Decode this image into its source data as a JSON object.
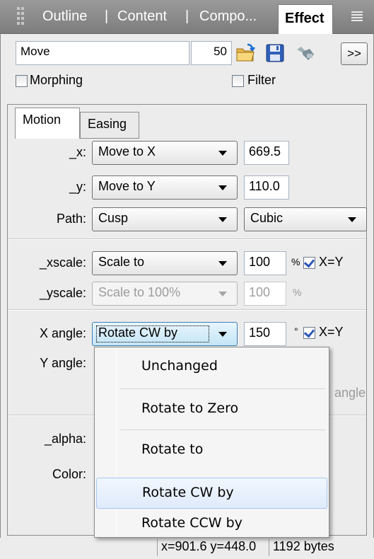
{
  "tabs": [
    {
      "label": "Outline"
    },
    {
      "label": "Content"
    },
    {
      "label": "Compo..."
    },
    {
      "label": "Effect"
    }
  ],
  "tabs_separator": "|",
  "effect": {
    "name_value": "Move",
    "frames_value": "50",
    "more_label": ">>"
  },
  "options": {
    "morphing_label": "Morphing",
    "morphing_checked": false,
    "filter_label": "Filter",
    "filter_checked": false
  },
  "subtabs": {
    "motion": "Motion",
    "easing": "Easing"
  },
  "motion": {
    "x_label": "_x:",
    "x_mode": "Move to X",
    "x_value": "669.5",
    "y_label": "_y:",
    "y_mode": "Move to Y",
    "y_value": "110.0",
    "path_label": "Path:",
    "path_mode": "Cusp",
    "path_curve": "Cubic",
    "xscale_label": "_xscale:",
    "xscale_mode": "Scale to",
    "xscale_value": "100",
    "xscale_unit": "%",
    "xy_label": "X=Y",
    "xy_checked": true,
    "yscale_label": "_yscale:",
    "yscale_mode": "Scale to 100%",
    "yscale_value": "100",
    "yscale_unit": "%",
    "xangle_label": "X angle:",
    "xangle_mode": "Rotate CW by",
    "xangle_value": "150",
    "xangle_unit": "°",
    "xangle_xy_label": "X=Y",
    "xangle_xy_checked": true,
    "yangle_label": "Y angle:",
    "angle_partial_label": "angle",
    "alpha_label": "_alpha:",
    "color_label": "Color:"
  },
  "dropdown_menu": {
    "items": [
      {
        "label": "Unchanged",
        "highlighted": false
      },
      {
        "label": "Rotate to Zero",
        "highlighted": false
      },
      {
        "label": "Rotate to",
        "highlighted": false
      },
      {
        "label": "Rotate CW by",
        "highlighted": true
      },
      {
        "label": "Rotate CCW by",
        "highlighted": false
      }
    ]
  },
  "status": {
    "coords": "x=901.6 y=448.0",
    "size": "1192 bytes"
  },
  "colors": {
    "tabbar": "#8a8a8a",
    "panel": "#ececec",
    "highlight": "#dfeafb",
    "check_blue": "#2b56b8"
  },
  "icons": [
    "grip-icon",
    "panel-menu-icon",
    "open-folder-icon",
    "save-disk-icon",
    "tool-icon"
  ]
}
